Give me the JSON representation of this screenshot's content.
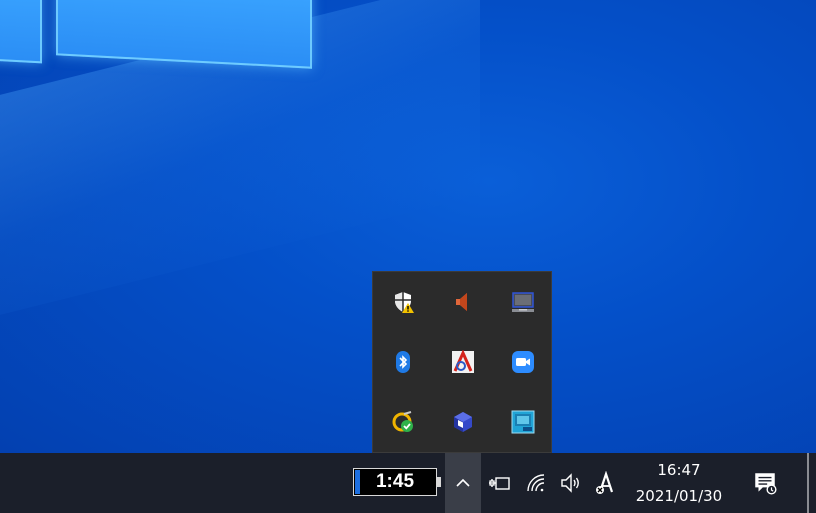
{
  "tray_popup": {
    "icons": [
      {
        "name": "windows-security-warning-icon"
      },
      {
        "name": "speaker-app-icon"
      },
      {
        "name": "display-app-icon"
      },
      {
        "name": "bluetooth-icon"
      },
      {
        "name": "acrobat-app-icon"
      },
      {
        "name": "zoom-video-icon"
      },
      {
        "name": "sync-check-icon"
      },
      {
        "name": "cube-app-icon"
      },
      {
        "name": "intel-graphics-icon"
      }
    ]
  },
  "taskbar": {
    "battery_time": "1:45",
    "tray_icons": [
      "power-plug-icon",
      "wifi-icon",
      "volume-icon",
      "ime-a-icon"
    ],
    "clock": {
      "time": "16:47",
      "date": "2021/01/30"
    }
  },
  "colors": {
    "desktop": "#0450c9",
    "taskbar": "#1b1f2a",
    "popup": "#2b2b2b",
    "accent_blue": "#1e6fe0"
  }
}
